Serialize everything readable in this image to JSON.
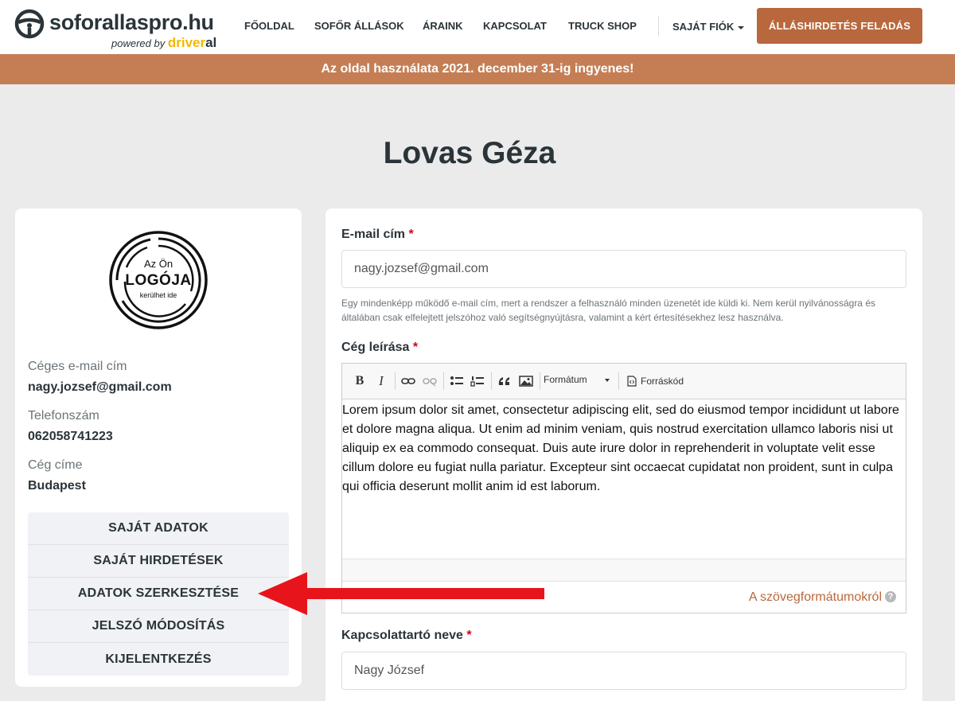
{
  "header": {
    "brand_name": "soforallaspro.hu",
    "brand_powered": "powered by",
    "brand_driver": "driver",
    "brand_al": "al",
    "nav": [
      "FŐOLDAL",
      "SOFŐR ÁLLÁSOK",
      "ÁRAINK",
      "KAPCSOLAT",
      "TRUCK SHOP"
    ],
    "account_label": "SAJÁT FIÓK",
    "post_button": "ÁLLÁSHIRDETÉS FELADÁS"
  },
  "banner": {
    "text": "Az oldal használata 2021. december 31-ig ingyenes!"
  },
  "page": {
    "title": "Lovas Géza"
  },
  "profile": {
    "logo_line1": "Az Ön",
    "logo_line2": "LOGÓJA",
    "logo_line3": "kerülhet ide",
    "email_label": "Céges e-mail cím",
    "email_value": "nagy.jozsef@gmail.com",
    "phone_label": "Telefonszám",
    "phone_value": "062058741223",
    "address_label": "Cég címe",
    "address_value": "Budapest"
  },
  "menu": [
    "SAJÁT ADATOK",
    "SAJÁT HIRDETÉSEK",
    "ADATOK SZERKESZTÉSE",
    "JELSZÓ MÓDOSÍTÁS",
    "KIJELENTKEZÉS"
  ],
  "form": {
    "email_label": "E-mail cím",
    "required_mark": "*",
    "email_value": "nagy.jozsef@gmail.com",
    "email_help": "Egy mindenképp működő e-mail cím, mert a rendszer a felhasználó minden üzenetét ide küldi ki. Nem kerül nyilvánosságra és általában csak elfelejtett jelszóhoz való segítségnyújtásra, valamint a kért értesítésekhez lesz használva.",
    "description_label": "Cég leírása",
    "toolbar": {
      "bold": "B",
      "italic": "I",
      "format": "Formátum",
      "source": "Forráskód"
    },
    "description_text": "Lorem ipsum dolor sit amet, consectetur adipiscing elit, sed do eiusmod tempor incididunt ut labore et dolore magna aliqua. Ut enim ad minim veniam, quis nostrud exercitation ullamco laboris nisi ut aliquip ex ea commodo consequat. Duis aute irure dolor in reprehenderit in voluptate velit esse cillum dolore eu fugiat nulla pariatur. Excepteur sint occaecat cupidatat non proident, sunt in culpa qui officia deserunt mollit anim id est laborum.",
    "format_help_link": "A szövegformátumokról",
    "help_icon": "?",
    "contact_label": "Kapcsolattartó neve",
    "contact_value": "Nagy József"
  },
  "colors": {
    "accent": "#b9683d",
    "banner": "#c57e54",
    "arrow": "#e8141b"
  }
}
